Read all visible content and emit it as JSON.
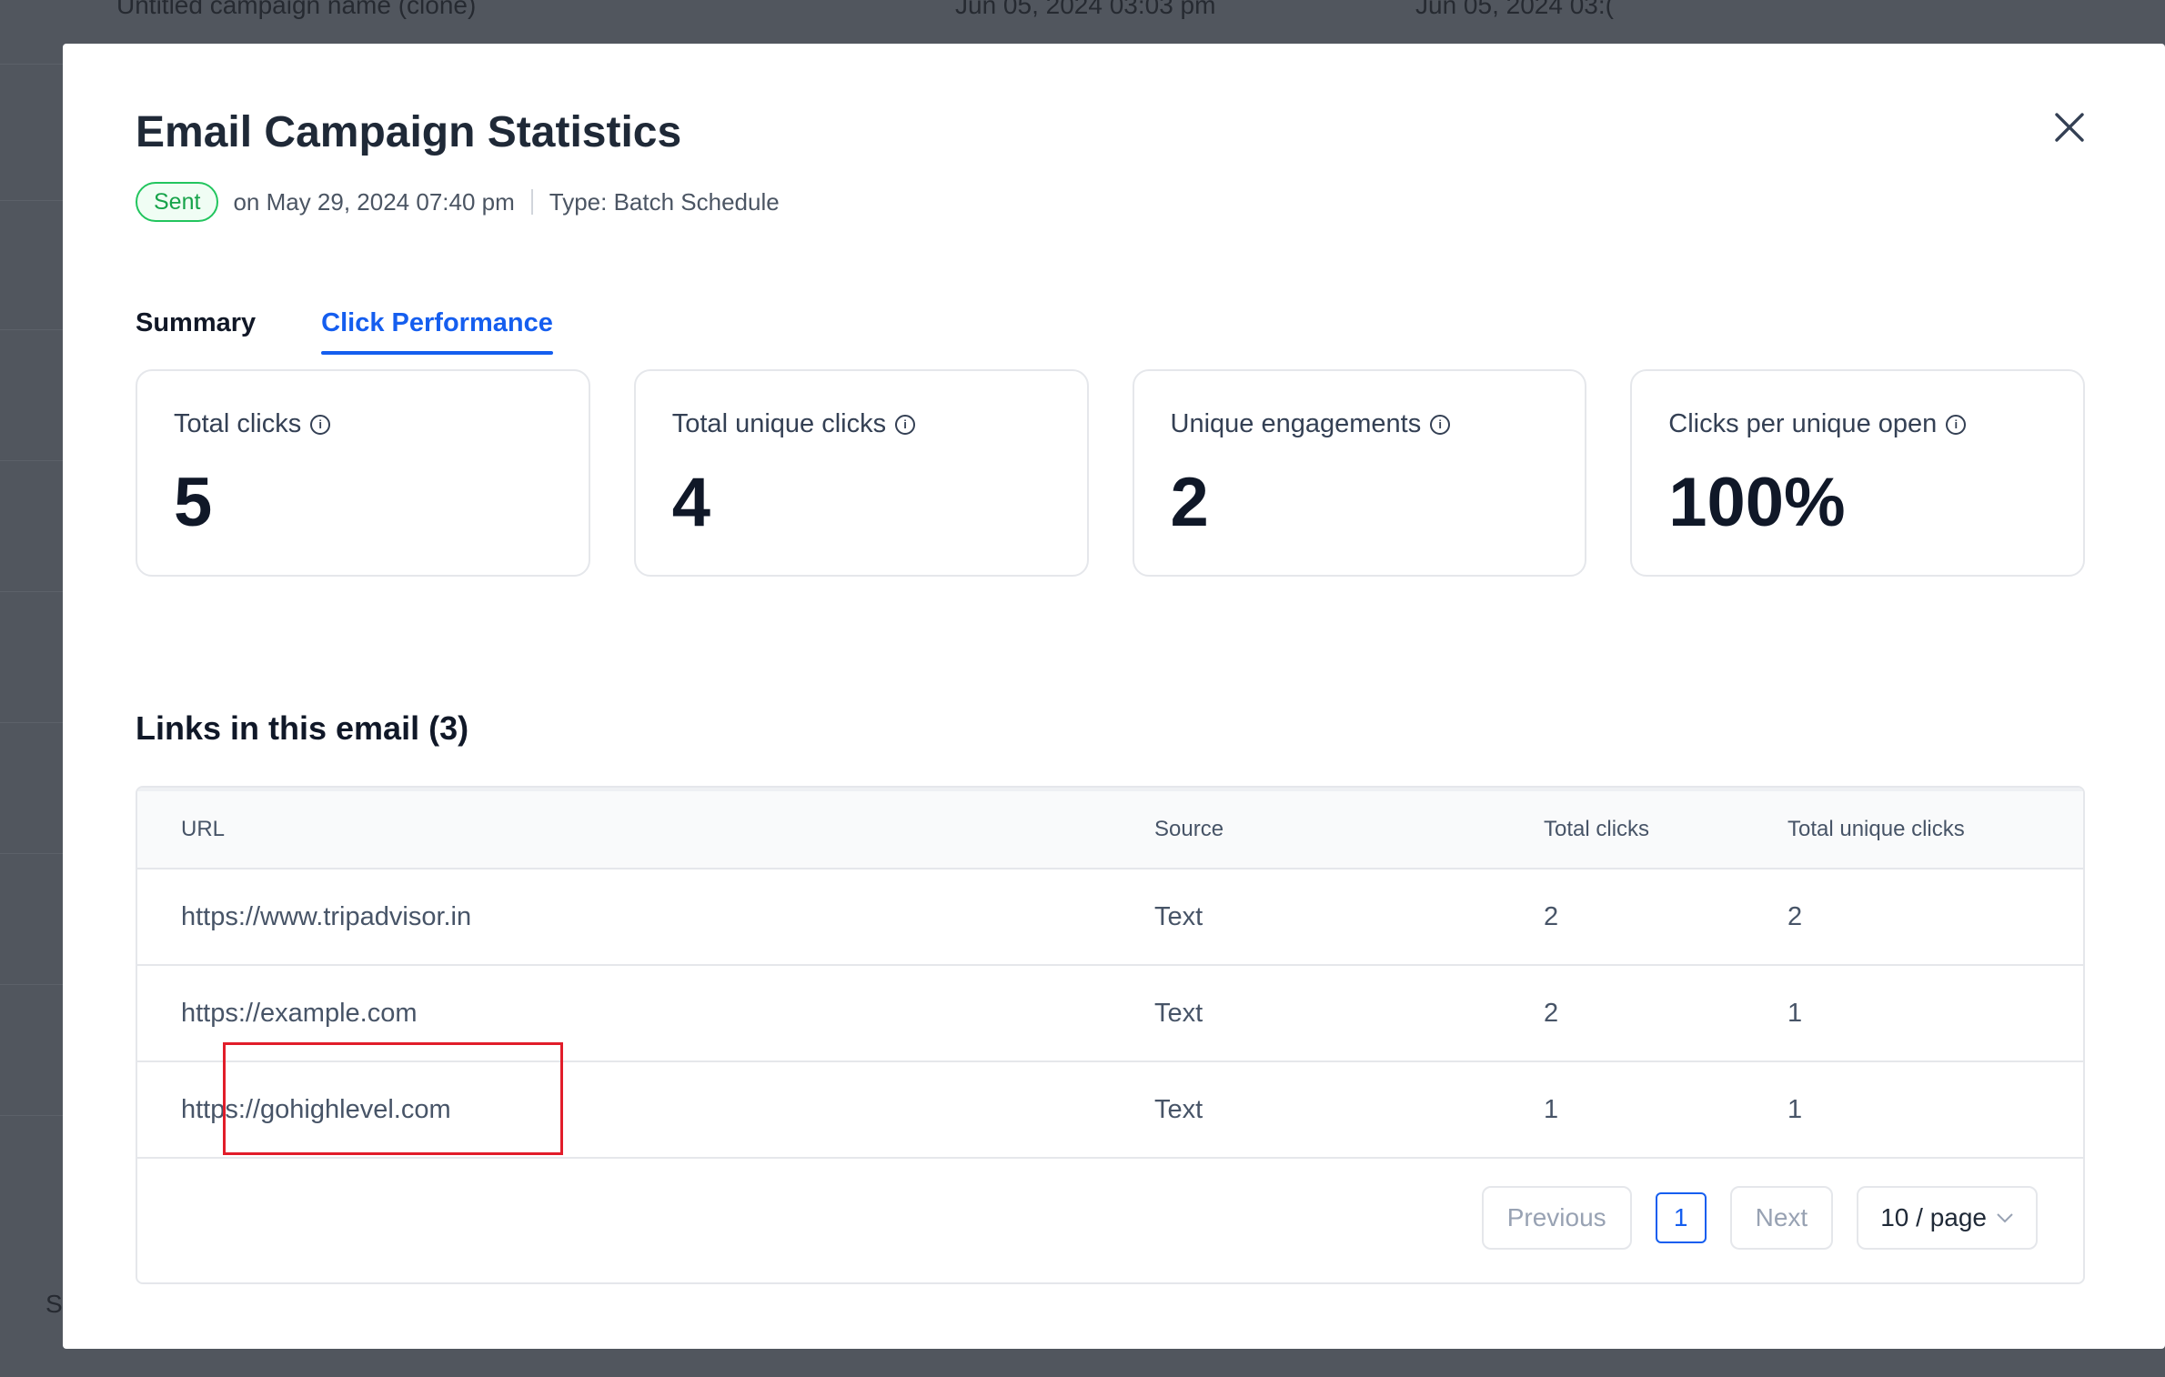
{
  "background": {
    "row_title": "Untitled campaign name (clone)",
    "row_date_1": "Jun 05, 2024 03:03 pm",
    "row_date_2": "Jun 05, 2024 03:(",
    "corner_letter": "S"
  },
  "modal": {
    "title": "Email Campaign Statistics",
    "status_badge": "Sent",
    "sent_on": "on May 29, 2024 07:40 pm",
    "type": "Type: Batch Schedule",
    "tabs": [
      {
        "label": "Summary",
        "active": false
      },
      {
        "label": "Click Performance",
        "active": true
      }
    ],
    "stats": [
      {
        "label": "Total clicks",
        "value": "5"
      },
      {
        "label": "Total unique clicks",
        "value": "4"
      },
      {
        "label": "Unique engagements",
        "value": "2"
      },
      {
        "label": "Clicks per unique open",
        "value": "100%"
      }
    ],
    "links_heading": "Links in this email (3)",
    "table": {
      "headers": [
        "URL",
        "Source",
        "Total clicks",
        "Total unique clicks"
      ],
      "rows": [
        {
          "url": "https://www.tripadvisor.in",
          "source": "Text",
          "total": "2",
          "unique": "2"
        },
        {
          "url": "https://example.com",
          "source": "Text",
          "total": "2",
          "unique": "1"
        },
        {
          "url": "https://gohighlevel.com",
          "source": "Text",
          "total": "1",
          "unique": "1"
        }
      ]
    },
    "pagination": {
      "previous": "Previous",
      "page": "1",
      "next": "Next",
      "page_size": "10 / page"
    }
  },
  "colors": {
    "accent": "#155eef",
    "sent_green": "#16a34a",
    "highlight_red": "#e11d2a"
  }
}
